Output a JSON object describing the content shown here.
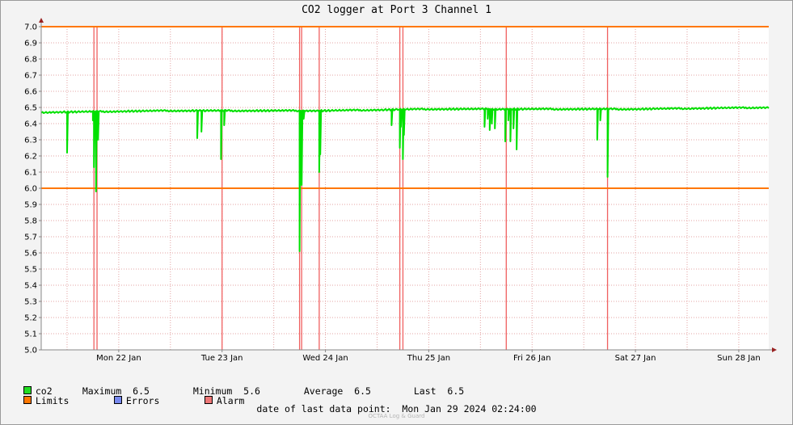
{
  "chart_data": {
    "type": "line",
    "title": "CO2 logger at Port 3 Channel 1",
    "ylim": [
      5.0,
      7.0
    ],
    "yticks": [
      "5.0",
      "5.1",
      "5.2",
      "5.3",
      "5.4",
      "5.5",
      "5.6",
      "5.7",
      "5.8",
      "5.9",
      "6.0",
      "6.1",
      "6.2",
      "6.3",
      "6.4",
      "6.5",
      "6.6",
      "6.7",
      "6.8",
      "6.9",
      "7.0"
    ],
    "xrange_days": [
      21.25,
      28.29
    ],
    "xticks": [
      {
        "label": "Mon 22 Jan",
        "day": 22
      },
      {
        "label": "Tue 23 Jan",
        "day": 23
      },
      {
        "label": "Wed 24 Jan",
        "day": 24
      },
      {
        "label": "Thu 25 Jan",
        "day": 25
      },
      {
        "label": "Fri 26 Jan",
        "day": 26
      },
      {
        "label": "Sat 27 Jan",
        "day": 27
      },
      {
        "label": "Sun 28 Jan",
        "day": 28
      }
    ],
    "grid": true,
    "limits": [
      6.0,
      7.0
    ],
    "alarm_times_day": [
      21.76,
      21.79,
      23.0,
      23.75,
      23.77,
      23.94,
      24.72,
      24.75,
      25.75,
      26.73
    ],
    "series": [
      {
        "name": "co2",
        "color": "#00e000",
        "baseline": [
          [
            21.25,
            6.47
          ],
          [
            22.5,
            6.48
          ],
          [
            24.0,
            6.48
          ],
          [
            25.0,
            6.49
          ],
          [
            27.0,
            6.49
          ],
          [
            28.29,
            6.5
          ]
        ],
        "dips": [
          [
            21.5,
            6.22
          ],
          [
            21.75,
            6.42
          ],
          [
            21.76,
            6.13
          ],
          [
            21.78,
            5.98
          ],
          [
            21.8,
            6.3
          ],
          [
            22.76,
            6.31
          ],
          [
            22.8,
            6.35
          ],
          [
            22.99,
            6.18
          ],
          [
            23.02,
            6.39
          ],
          [
            23.75,
            5.61
          ],
          [
            23.77,
            6.02
          ],
          [
            23.79,
            6.43
          ],
          [
            23.94,
            6.1
          ],
          [
            23.95,
            6.21
          ],
          [
            24.64,
            6.39
          ],
          [
            24.72,
            6.25
          ],
          [
            24.73,
            6.38
          ],
          [
            24.75,
            6.18
          ],
          [
            24.76,
            6.33
          ],
          [
            25.54,
            6.38
          ],
          [
            25.57,
            6.43
          ],
          [
            25.59,
            6.36
          ],
          [
            25.61,
            6.4
          ],
          [
            25.64,
            6.37
          ],
          [
            25.74,
            6.29
          ],
          [
            25.77,
            6.42
          ],
          [
            25.79,
            6.29
          ],
          [
            25.82,
            6.37
          ],
          [
            25.85,
            6.24
          ],
          [
            26.63,
            6.3
          ],
          [
            26.66,
            6.42
          ],
          [
            26.73,
            6.07
          ]
        ]
      }
    ]
  },
  "legend": {
    "co2_label": "co2",
    "maximum": "Maximum  6.5",
    "minimum": "Minimum  5.6",
    "average": "Average  6.5",
    "last": "Last  6.5",
    "limits_label": "Limits",
    "errors_label": "Errors",
    "alarm_label": "Alarm",
    "colors": {
      "co2": "#22dd22",
      "limits": "#ff7700",
      "errors": "#7788ee",
      "alarm": "#ee7777"
    }
  },
  "footer": {
    "last_point": "date of last data point:  Mon Jan 29 2024 02:24:00",
    "watermark": "OCTAA Log & Guard"
  }
}
